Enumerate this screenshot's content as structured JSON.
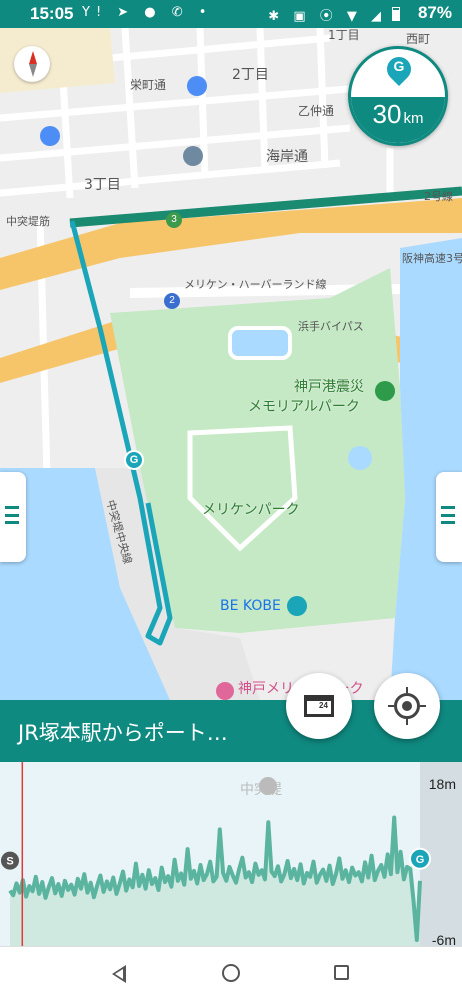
{
  "status_bar": {
    "time": "15:05",
    "left_icons": [
      "yahoo-icon",
      "navigation-icon",
      "bulb-icon",
      "phone-icon",
      "dot-icon"
    ],
    "right_icons": [
      "bluetooth-icon",
      "nfc-icon",
      "location-icon",
      "wifi-icon",
      "lte-icon",
      "battery-icon"
    ],
    "lefticons_text": "Y! ➤ ● ✆ •",
    "righticons_text": "✱ ▣ ⦿ ▼ ◢",
    "battery": "87%"
  },
  "map": {
    "labels": {
      "chome1": "1丁目",
      "nishimachi": "西町",
      "sakaemachi": "栄町通",
      "chome2": "2丁目",
      "otsunaka": "乙仲通",
      "kaigan": "海岸通",
      "chome3": "3丁目",
      "chutotsuji": "中突堤筋",
      "route2": "2号線",
      "hanshin": "阪神高速3号",
      "meriken_harbor": "メリケン・ハーバーランド線",
      "hamate": "浜手バイパス",
      "memorial1": "神戸港震災",
      "memorial2": "メモリアルパーク",
      "meriken_park": "メリケンパーク",
      "be_kobe": "BE KOBE",
      "kobe_meriken_hotel": "神戸メリケンパーク",
      "chutotsuji_road": "中突堤中央線"
    },
    "shields": {
      "shield3": "3",
      "shield2": "2"
    },
    "route_color": "#1aa5b8",
    "water_color": "#aadaff",
    "park_color": "#c5e8c5",
    "goal_marker": "G"
  },
  "distance_badge": {
    "marker": "G",
    "value": "30",
    "unit": "km"
  },
  "title_bar": {
    "title": "JR塚本駅からポート…"
  },
  "store_button": {
    "label": "24"
  },
  "elevation": {
    "top_label": "18m",
    "bottom_label": "-6m",
    "watermark": "中突堤",
    "start_marker": "S",
    "end_marker": "G"
  },
  "chart_data": {
    "type": "area",
    "title": "",
    "xlabel": "",
    "ylabel": "",
    "ylim": [
      -6,
      18
    ],
    "series": [
      {
        "values": [
          1.5,
          0.8,
          2.6,
          1.2,
          3.1,
          0.6,
          2.2,
          1.4,
          3.6,
          1.0,
          2.8,
          0.4,
          2.0,
          3.4,
          1.1,
          2.5,
          0.7,
          3.0,
          1.6,
          2.4,
          0.9,
          3.3,
          1.8,
          4.0,
          1.2,
          2.7,
          0.5,
          2.3,
          3.8,
          1.3,
          2.9,
          1.7,
          3.5,
          1.0,
          2.6,
          4.4,
          1.5,
          3.2,
          2.0,
          5.6,
          2.2,
          3.9,
          1.8,
          4.6,
          2.5,
          3.4,
          1.6,
          5.0,
          2.8,
          3.7,
          2.1,
          6.2,
          3.0,
          4.1,
          2.4,
          7.8,
          3.3,
          4.5,
          2.6,
          5.4,
          3.1,
          4.0,
          5.9,
          2.9,
          3.6,
          10.8,
          4.2,
          3.0,
          5.1,
          3.8,
          2.7,
          4.8,
          6.5,
          3.5,
          4.3,
          2.8,
          5.6,
          3.9,
          4.6,
          3.2,
          11.9,
          4.4,
          3.7,
          5.2,
          2.9,
          4.0,
          6.0,
          3.4,
          4.8,
          3.1,
          5.5,
          2.6,
          4.2,
          3.6,
          5.9,
          2.7,
          3.9,
          4.7,
          3.0,
          5.3,
          2.5,
          4.1,
          6.4,
          3.3,
          4.6,
          2.8,
          5.0,
          3.8,
          4.3,
          2.9,
          5.8,
          3.5,
          6.8,
          3.1,
          4.5,
          5.4,
          3.6,
          7.0,
          4.0,
          12.6,
          4.3,
          7.4,
          3.2,
          5.1,
          4.8,
          0.0,
          -6.0,
          3.0
        ]
      }
    ],
    "start_marker": "S",
    "goal_marker": "G",
    "current_position_fraction": 0.03
  }
}
